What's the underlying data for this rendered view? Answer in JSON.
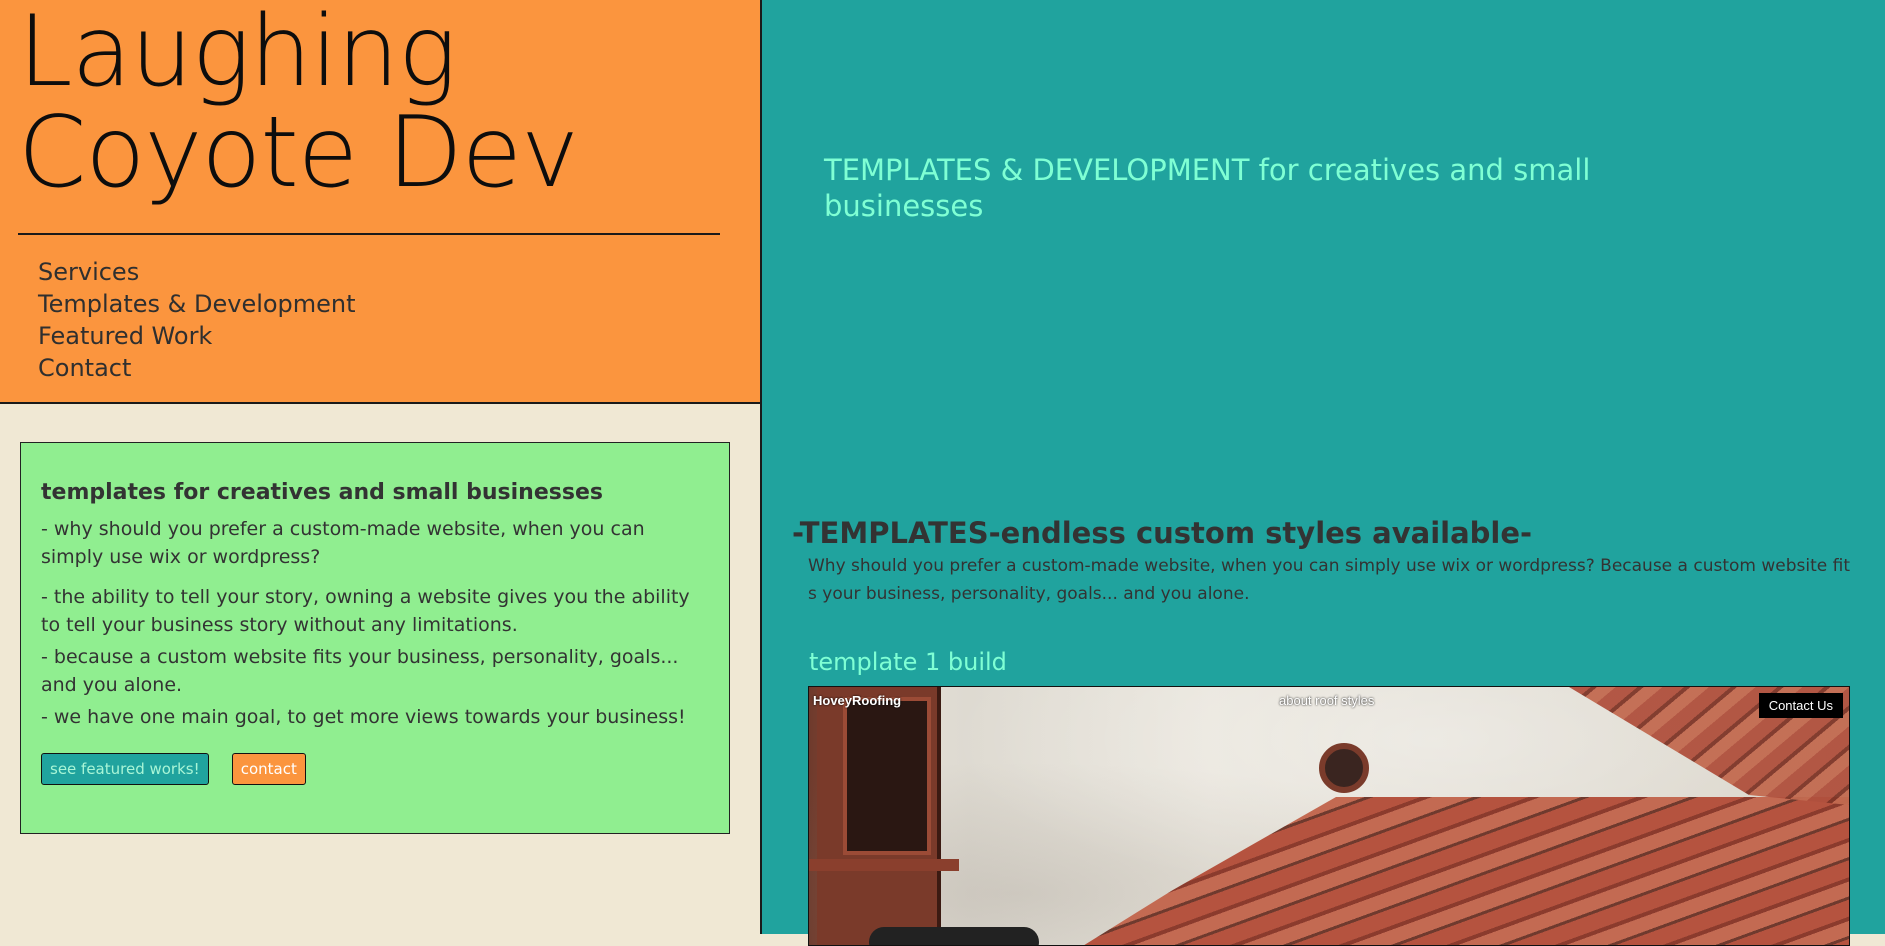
{
  "header": {
    "site_title": "Laughing Coyote Dev",
    "bg_color": "#fb953e"
  },
  "nav": {
    "items": [
      {
        "label": "Services"
      },
      {
        "label": "Templates & Development"
      },
      {
        "label": "Featured Work"
      },
      {
        "label": "Contact"
      }
    ]
  },
  "card": {
    "heading": "templates for creatives and small businesses",
    "paragraphs": [
      "- why should you prefer a custom-made website, when you can simply use wix or wordpress?",
      "- the ability to tell your story, owning a website gives you the ability to tell your business story without any limitations.",
      "- because a custom website fits your business, personality, goals... and you alone.",
      "- we have one main goal, to get more views towards your business!"
    ],
    "buttons": {
      "featured": "see featured works!",
      "contact": "contact"
    },
    "bg_color": "#90ee90"
  },
  "main": {
    "tagline": "TEMPLATES & DEVELOPMENT for creatives and small businesses",
    "templates_heading": "-TEMPLATES-endless custom styles available-",
    "templates_description": "Why should you prefer a custom-made website, when you can simply use wix or wordpress? Because a custom website fit s your business, personality, goals... and you alone.",
    "template_label": "template 1 build",
    "bg_color": "#20a39e",
    "accent_text_color": "#7fffd4"
  },
  "preview": {
    "brand": "HoveyRoofing",
    "nav_link": "about roof styles",
    "contact_button": "Contact Us"
  }
}
